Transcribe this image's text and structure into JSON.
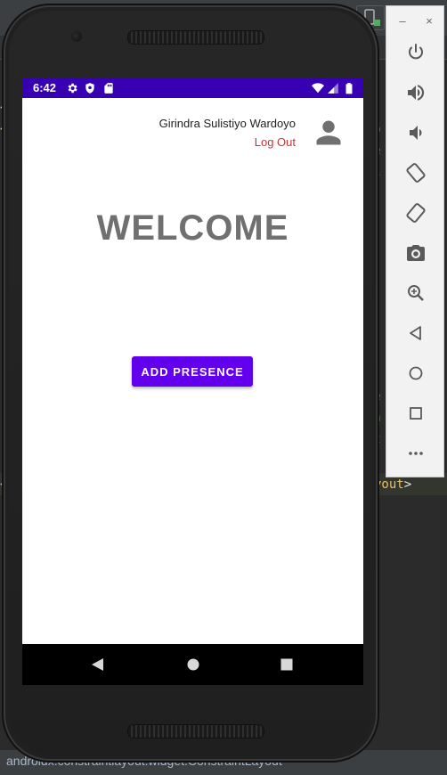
{
  "ide": {
    "status_text": "androidx.constraintlayout.widget.ConstraintLayout",
    "code_tail_text": "yout",
    "code_tail_bracket": ">",
    "gutter_marks": [
      "<",
      "<",
      "<"
    ]
  },
  "emulator": {
    "toolbar": {
      "minimize_label": "–",
      "close_label": "×",
      "buttons": [
        {
          "name": "power",
          "icon": "power-icon"
        },
        {
          "name": "volume-up",
          "icon": "volume-up-icon"
        },
        {
          "name": "volume-down",
          "icon": "volume-down-icon"
        },
        {
          "name": "rotate-left",
          "icon": "rotate-left-icon"
        },
        {
          "name": "rotate-right",
          "icon": "rotate-right-icon"
        },
        {
          "name": "screenshot",
          "icon": "camera-icon"
        },
        {
          "name": "zoom",
          "icon": "zoom-in-icon"
        },
        {
          "name": "back",
          "icon": "back-triangle-icon"
        },
        {
          "name": "home",
          "icon": "home-circle-icon"
        },
        {
          "name": "overview",
          "icon": "overview-square-icon"
        },
        {
          "name": "more",
          "icon": "more-dots-icon"
        }
      ]
    }
  },
  "device": {
    "status_bar": {
      "time": "6:42",
      "color": "#3700b3"
    },
    "app": {
      "user_name": "Girindra Sulistiyo Wardoyo",
      "logout_label": "Log Out",
      "welcome_text": "WELCOME",
      "add_presence_label": "ADD PRESENCE",
      "accent_color": "#6200ee",
      "logout_color": "#d32f2f"
    }
  }
}
